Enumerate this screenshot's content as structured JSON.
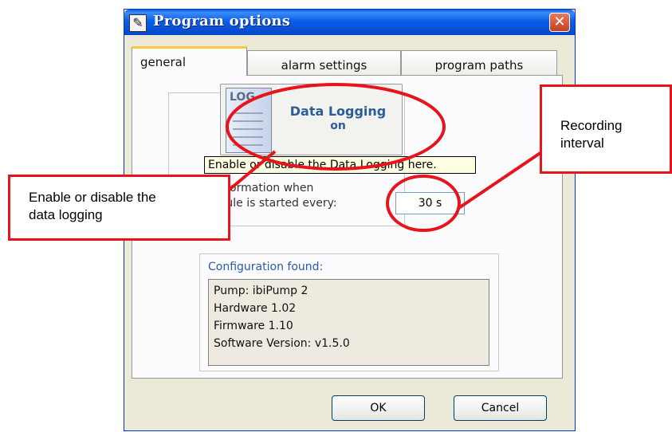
{
  "window": {
    "title": "Program options",
    "close_icon": "close-icon"
  },
  "tabs": [
    {
      "label": "general",
      "active": true
    },
    {
      "label": "alarm settings",
      "active": false
    },
    {
      "label": "program paths",
      "active": false
    }
  ],
  "logging": {
    "icon_text": "LOG",
    "button_label": "Data Logging",
    "state": "on",
    "tooltip": "Enable or disable the Data Logging here.",
    "info_line1": "g information when",
    "info_line2": "hedule is started every:",
    "interval_value": "30 s"
  },
  "configuration": {
    "title": "Configuration found:",
    "lines": [
      "Pump: ibiPump 2",
      "Hardware 1.02",
      "Firmware 1.10",
      "Software Version: v1.5.0"
    ]
  },
  "buttons": {
    "ok": "OK",
    "cancel": "Cancel"
  },
  "annotations": {
    "left_line1": "Enable or disable the",
    "left_line2": "data logging",
    "right_line1": "Recording",
    "right_line2": "interval",
    "color": "#e8141b"
  }
}
